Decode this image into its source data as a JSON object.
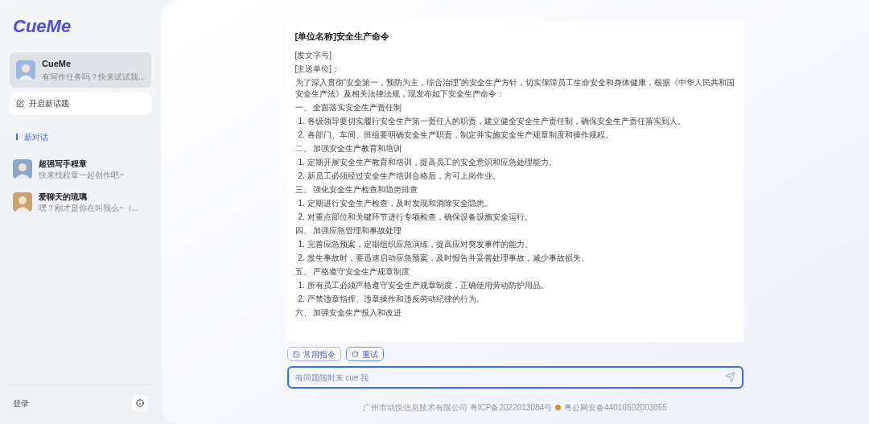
{
  "logo": "CueMe",
  "sidebar": {
    "agents": [
      {
        "name": "CueMe",
        "preview": "有写作任务吗？快来试试我...",
        "selected": true
      }
    ],
    "new_topic": "开启新话题",
    "conversations": [
      {
        "title": "新对话",
        "selected": true
      }
    ],
    "characters": [
      {
        "name": "超强写手程章",
        "preview": "快来找程章一起创作吧~"
      },
      {
        "name": "爱聊天的琉璃",
        "preview": "嘿？刚才是你在叫我么~（..."
      }
    ],
    "login": "登录"
  },
  "document": {
    "title": "[单位名称]安全生产命令",
    "lines": [
      {
        "kind": "para",
        "text": "[发文字号]"
      },
      {
        "kind": "para",
        "text": "[主送单位]："
      },
      {
        "kind": "para",
        "text": "为了深入贯彻“安全第一，预防为主，综合治理”的安全生产方针，切实保障员工生命安全和身体健康，根据《中华人民共和国安全生产法》及相关法律法规，现发布如下安全生产命令："
      },
      {
        "kind": "section",
        "text": "一、 全面落实安全生产责任制"
      },
      {
        "kind": "item",
        "text": "1. 各级领导要切实履行安全生产第一责任人的职责，建立健全安全生产责任制，确保安全生产责任落实到人。"
      },
      {
        "kind": "item",
        "text": "2. 各部门、车间、班组要明确安全生产职责，制定并实施安全生产规章制度和操作规程。"
      },
      {
        "kind": "section",
        "text": "二、 加强安全生产教育和培训"
      },
      {
        "kind": "item",
        "text": "1. 定期开展安全生产教育和培训，提高员工的安全意识和应急处理能力。"
      },
      {
        "kind": "item",
        "text": "2. 新员工必须经过安全生产培训合格后，方可上岗作业。"
      },
      {
        "kind": "section",
        "text": "三、 强化安全生产检查和隐患排查"
      },
      {
        "kind": "item",
        "text": "1. 定期进行安全生产检查，及时发现和消除安全隐患。"
      },
      {
        "kind": "item",
        "text": "2. 对重点部位和关键环节进行专项检查，确保设备设施安全运行。"
      },
      {
        "kind": "section",
        "text": "四、 加强应急管理和事故处理"
      },
      {
        "kind": "item",
        "text": "1. 完善应急预案，定期组织应急演练，提高应对突发事件的能力。"
      },
      {
        "kind": "item",
        "text": "2. 发生事故时，要迅速启动应急预案，及时报告并妥善处理事故，减少事故损失。"
      },
      {
        "kind": "section",
        "text": "五、 严格遵守安全生产规章制度"
      },
      {
        "kind": "item",
        "text": "1. 所有员工必须严格遵守安全生产规章制度，正确使用劳动防护用品。"
      },
      {
        "kind": "item",
        "text": "2. 严禁违章指挥、违章操作和违反劳动纪律的行为。"
      },
      {
        "kind": "section",
        "text": "六、 加强安全生产投入和改进"
      }
    ]
  },
  "actions": [
    "常用指令",
    "重试"
  ],
  "input": {
    "placeholder": "有问题随时来 cue 我"
  },
  "footer": {
    "company": "广州市动悦信息技术有限公司 粤ICP备2022013084号",
    "police": "粤公网安备44010502003055"
  }
}
